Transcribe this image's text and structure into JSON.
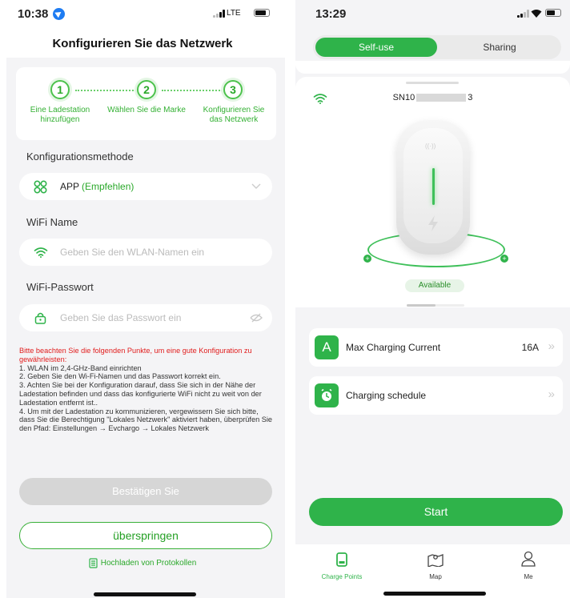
{
  "left": {
    "status_time": "10:38",
    "network": "LTE",
    "page_title": "Konfigurieren Sie das Netzwerk",
    "steps": [
      {
        "number": "1",
        "label_line1": "Eine Ladestation",
        "label_line2": "hinzufügen"
      },
      {
        "number": "2",
        "label_line1": "Wählen Sie die Marke",
        "label_line2": ""
      },
      {
        "number": "3",
        "label_line1": "Konfigurieren Sie",
        "label_line2": "das Netzwerk"
      }
    ],
    "config_method_label": "Konfigurationsmethode",
    "config_method_value": "APP",
    "config_method_recommend": "(Empfehlen)",
    "wifi_name_label": "WiFi Name",
    "wifi_name_placeholder": "Geben Sie den WLAN-Namen ein",
    "wifi_password_label": "WiFi-Passwort",
    "wifi_password_placeholder": "Geben Sie das Passwort ein",
    "notice_warning": "Bitte beachten Sie die folgenden Punkte, um eine gute Konfiguration zu gewährleisten:",
    "notice_items": [
      "1. WLAN im 2,4-GHz-Band einrichten",
      "2. Geben Sie den Wi-Fi-Namen und das Passwort korrekt ein.",
      "3. Achten Sie bei der Konfiguration darauf, dass Sie sich in der Nähe der Ladestation befinden und dass das konfigurierte WiFi nicht zu weit von der Ladestation entfernt ist..",
      "4. Um mit der Ladestation zu kommunizieren, vergewissern Sie sich bitte, dass Sie die Berechtigung \"Lokales Netzwerk\" aktiviert haben, überprüfen Sie den Pfad: Einstellungen → Evchargo → Lokales Netzwerk"
    ],
    "confirm_button": "Bestätigen Sie",
    "skip_button": "überspringen",
    "upload_logs": "Hochladen von Protokollen"
  },
  "right": {
    "status_time": "13:29",
    "toggle": {
      "active": "Self-use",
      "inactive": "Sharing"
    },
    "serial_prefix": "SN10",
    "serial_suffix": "3",
    "status_badge": "Available",
    "rows": [
      {
        "icon_letter": "A",
        "label": "Max Charging Current",
        "value": "16A"
      },
      {
        "icon_letter": "",
        "label": "Charging schedule",
        "value": ""
      }
    ],
    "start_button": "Start",
    "tabs": [
      {
        "label": "Charge Points",
        "active": true
      },
      {
        "label": "Map",
        "active": false
      },
      {
        "label": "Me",
        "active": false
      }
    ]
  },
  "colors": {
    "accent": "#2fb34a",
    "warning": "#e11d1d",
    "background": "#f4f4f6"
  }
}
